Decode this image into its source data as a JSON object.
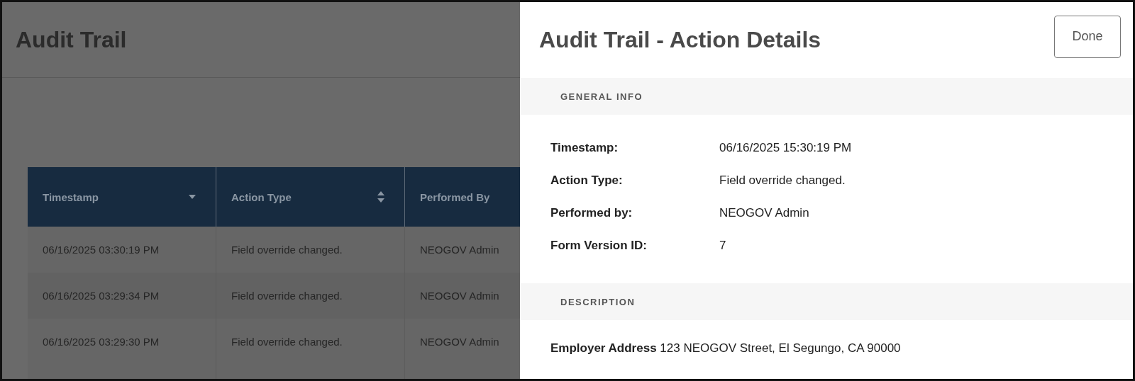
{
  "page": {
    "title": "Audit Trail"
  },
  "table": {
    "columns": [
      {
        "label": "Timestamp",
        "sortable": true,
        "sorted": true
      },
      {
        "label": "Action Type",
        "sortable": true,
        "sorted": false
      },
      {
        "label": "Performed By"
      }
    ],
    "rows": [
      [
        "06/16/2025 03:30:19 PM",
        "Field override changed.",
        "NEOGOV Admin"
      ],
      [
        "06/16/2025 03:29:34 PM",
        "Field override changed.",
        "NEOGOV Admin"
      ],
      [
        "06/16/2025 03:29:30 PM",
        "Field override changed.",
        "NEOGOV Admin"
      ]
    ]
  },
  "panel": {
    "title": "Audit Trail - Action Details",
    "done_button": "Done",
    "sections": [
      {
        "heading": "GENERAL INFO",
        "kind": "fields",
        "fields": [
          {
            "label": "Timestamp:",
            "value": "06/16/2025 15:30:19 PM"
          },
          {
            "label": "Action Type:",
            "value": "Field override changed."
          },
          {
            "label": "Performed by:",
            "value": "NEOGOV Admin"
          },
          {
            "label": "Form Version ID:",
            "value": "7"
          }
        ]
      },
      {
        "heading": "DESCRIPTION",
        "kind": "text",
        "text": "**Employer Address** 123 NEOGOV Street, El Segungo, CA 90000"
      }
    ]
  }
}
